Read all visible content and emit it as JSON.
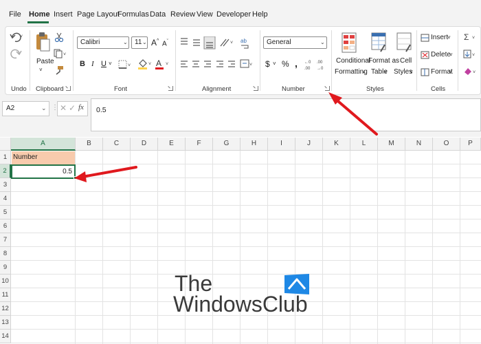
{
  "menu": {
    "tabs": [
      "File",
      "Home",
      "Insert",
      "Page Layout",
      "Formulas",
      "Data",
      "Review",
      "View",
      "Developer",
      "Help"
    ],
    "active": "Home"
  },
  "ribbon": {
    "undo": {
      "label": "Undo"
    },
    "clipboard": {
      "label": "Clipboard",
      "paste_label": "Paste"
    },
    "font": {
      "label": "Font",
      "name": "Calibri",
      "size": "11"
    },
    "alignment": {
      "label": "Alignment"
    },
    "number": {
      "label": "Number",
      "format": "General"
    },
    "styles": {
      "label": "Styles",
      "conditional_line1": "Conditional",
      "conditional_line2": "Formatting",
      "format_table_line1": "Format as",
      "format_table_line2": "Table",
      "cell_styles_line1": "Cell",
      "cell_styles_line2": "Styles"
    },
    "cells": {
      "label": "Cells",
      "insert": "Insert",
      "delete": "Delete",
      "format": "Format"
    }
  },
  "formula_bar": {
    "name_box": "A2",
    "fx": "fx",
    "value": "0.5"
  },
  "sheet": {
    "columns": [
      "A",
      "B",
      "C",
      "D",
      "E",
      "F",
      "G",
      "H",
      "I",
      "J",
      "K",
      "L",
      "M",
      "N",
      "O",
      "P"
    ],
    "rows": [
      "1",
      "2",
      "3",
      "4",
      "5",
      "6",
      "7",
      "8",
      "9",
      "10",
      "11",
      "12",
      "13",
      "14"
    ],
    "a1": "Number",
    "a2": "0.5"
  },
  "watermark": {
    "line1": "The",
    "line2": "WindowsClub"
  },
  "colors": {
    "accent": "#217346",
    "header_fill": "#f8cbad",
    "arrow": "#e0191e",
    "windows_blue": "#1e88e5"
  }
}
